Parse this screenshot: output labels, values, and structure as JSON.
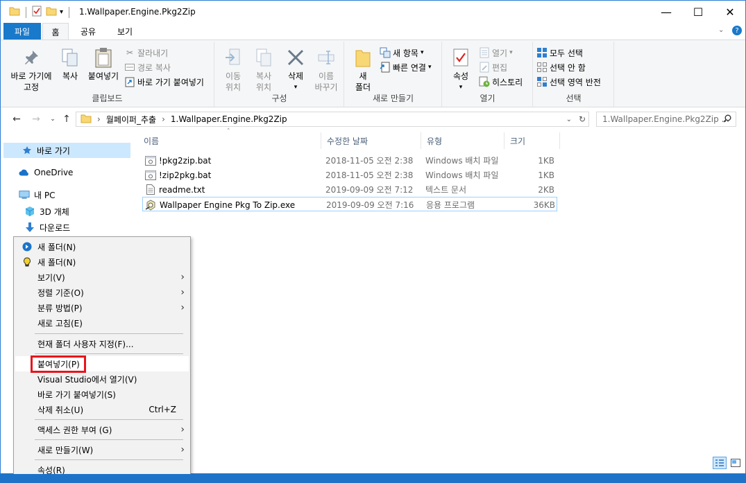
{
  "window": {
    "title": "1.Wallpaper.Engine.Pkg2Zip",
    "controls": {
      "minimize": "—",
      "maximize": "☐",
      "close": "✕"
    }
  },
  "ribbon_tabs": [
    "파일",
    "홈",
    "공유",
    "보기"
  ],
  "ribbon": {
    "clipboard": {
      "pin_label_1": "바로 가기에",
      "pin_label_2": "고정",
      "copy": "복사",
      "paste": "붙여넣기",
      "cut": "잘라내기",
      "copy_path": "경로 복사",
      "paste_shortcut": "바로 가기 붙여넣기",
      "group_label": "클립보드"
    },
    "organize": {
      "move_to_1": "이동",
      "move_to_2": "위치",
      "copy_to_1": "복사",
      "copy_to_2": "위치",
      "delete": "삭제",
      "rename_1": "이름",
      "rename_2": "바꾸기",
      "group_label": "구성"
    },
    "new": {
      "new_folder_1": "새",
      "new_folder_2": "폴더",
      "new_item": "새 항목",
      "easy_access": "빠른 연결",
      "group_label": "새로 만들기"
    },
    "open": {
      "properties": "속성",
      "open": "열기",
      "edit": "편집",
      "history": "히스토리",
      "group_label": "열기"
    },
    "select": {
      "select_all": "모두 선택",
      "select_none": "선택 안 함",
      "invert": "선택 영역 반전",
      "group_label": "선택"
    }
  },
  "address": {
    "crumbs": [
      "월페이퍼_추출",
      "1.Wallpaper.Engine.Pkg2Zip"
    ],
    "search_placeholder": "1.Wallpaper.Engine.Pkg2Zip ..."
  },
  "nav_pane": [
    {
      "label": "바로 가기",
      "icon": "star-icon"
    },
    {
      "label": "OneDrive",
      "icon": "cloud-icon"
    },
    {
      "label": "내 PC",
      "icon": "computer-icon"
    },
    {
      "label": "3D 개체",
      "icon": "cube-icon"
    },
    {
      "label": "다운로드",
      "icon": "download-icon"
    }
  ],
  "columns": [
    "이름",
    "수정한 날짜",
    "유형",
    "크기"
  ],
  "files": [
    {
      "name": "!pkg2zip.bat",
      "date": "2018-11-05 오전 2:38",
      "type": "Windows 배치 파일",
      "size": "1KB",
      "icon": "batch-file-icon"
    },
    {
      "name": "!zip2pkg.bat",
      "date": "2018-11-05 오전 2:38",
      "type": "Windows 배치 파일",
      "size": "1KB",
      "icon": "batch-file-icon"
    },
    {
      "name": "readme.txt",
      "date": "2019-09-09 오전 7:12",
      "type": "텍스트 문서",
      "size": "2KB",
      "icon": "text-file-icon"
    },
    {
      "name": "Wallpaper Engine Pkg To Zip.exe",
      "date": "2019-09-09 오전 7:16",
      "type": "응용 프로그램",
      "size": "36KB",
      "icon": "exe-file-icon"
    }
  ],
  "context_menu": {
    "items": [
      {
        "label": "새 폴더(N)",
        "icon": "blue-circle-icon"
      },
      {
        "label": "새 폴더(N)",
        "icon": "yellow-bulb-icon"
      },
      {
        "label": "보기(V)",
        "submenu": true
      },
      {
        "label": "정렬 기준(O)",
        "submenu": true
      },
      {
        "label": "분류 방법(P)",
        "submenu": true
      },
      {
        "label": "새로 고침(E)"
      },
      {
        "label": "현재 폴더 사용자 지정(F)..."
      },
      {
        "label": "붙여넣기(P)",
        "highlighted": true
      },
      {
        "label": "Visual Studio에서 열기(V)"
      },
      {
        "label": "바로 가기 붙여넣기(S)"
      },
      {
        "label": "삭제 취소(U)",
        "shortcut": "Ctrl+Z"
      },
      {
        "label": "액세스 권한 부여 (G)",
        "submenu": true
      },
      {
        "label": "새로 만들기(W)",
        "submenu": true
      },
      {
        "label": "속성(R)"
      }
    ]
  },
  "colors": {
    "accent": "#1979ca",
    "highlight": "#e8141b",
    "selection": "#cce8ff"
  }
}
